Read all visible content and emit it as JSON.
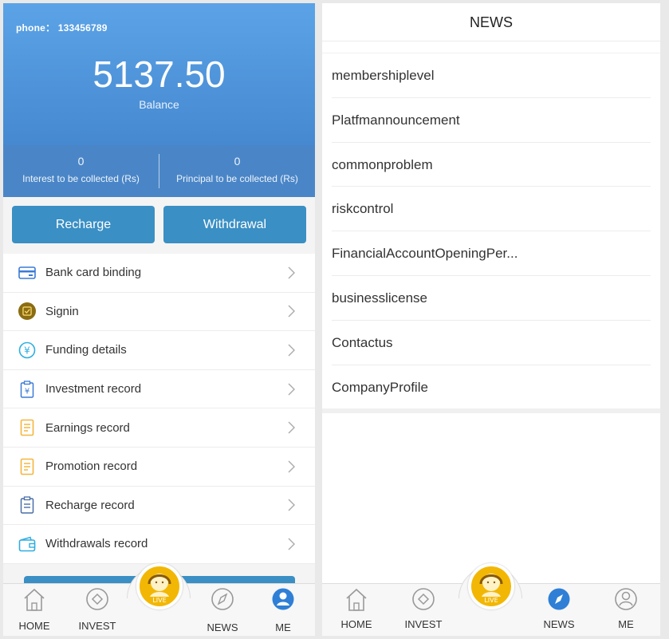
{
  "account": {
    "phone_label": "phone：",
    "phone": "133456789",
    "balance": "5137.50",
    "balance_label": "Balance",
    "interest_value": "0",
    "interest_label": "Interest to be collected (Rs)",
    "principal_value": "0",
    "principal_label": "Principal to be collected (Rs)"
  },
  "actions": {
    "recharge": "Recharge",
    "withdrawal": "Withdrawal"
  },
  "menu": [
    {
      "label": "Bank card binding",
      "icon": "bank-card-icon"
    },
    {
      "label": "Signin",
      "icon": "signin-icon"
    },
    {
      "label": "Funding details",
      "icon": "yen-icon"
    },
    {
      "label": "Investment record",
      "icon": "clipboard-yen-icon"
    },
    {
      "label": "Earnings record",
      "icon": "document-icon"
    },
    {
      "label": "Promotion record",
      "icon": "document-icon"
    },
    {
      "label": "Recharge record",
      "icon": "clipboard-icon"
    },
    {
      "label": "Withdrawals record",
      "icon": "wallet-icon"
    }
  ],
  "tabs": {
    "home": "HOME",
    "invest": "INVEST",
    "live": "LIVE",
    "news": "NEWS",
    "me": "ME"
  },
  "news": {
    "title": "NEWS",
    "items": [
      "membershiplevel",
      "Platfmannouncement",
      "commonproblem",
      "riskcontrol",
      "FinancialAccountOpeningPer...",
      "businesslicense",
      "Contactus",
      "CompanyProfile"
    ]
  },
  "colors": {
    "accent": "#3a8fc4",
    "header_top": "#5ba3e6",
    "header_bottom": "#3e7fc9",
    "live": "#f2b705"
  }
}
